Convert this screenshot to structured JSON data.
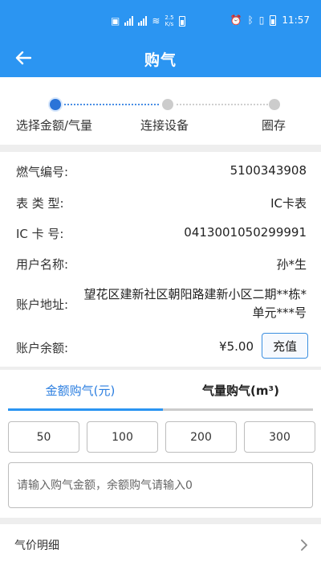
{
  "status_bar": {
    "net_speed_value": "2.5",
    "net_speed_unit": "K/s",
    "time": "11:57"
  },
  "header": {
    "title": "购气"
  },
  "steps": [
    {
      "label": "选择金额/气量",
      "state": "active"
    },
    {
      "label": "连接设备",
      "state": "inactive"
    },
    {
      "label": "圈存",
      "state": "inactive"
    }
  ],
  "info": {
    "gas_number_label": "燃气编号:",
    "gas_number_value": "5100343908",
    "meter_type_label": "表 类 型:",
    "meter_type_value": "IC卡表",
    "ic_card_label": "IC 卡 号:",
    "ic_card_value": "0413001050299991",
    "user_name_label": "用户名称:",
    "user_name_value": "孙*生",
    "address_label": "账户地址:",
    "address_value": "望花区建新社区朝阳路建新小区二期**栋*单元***号",
    "balance_label": "账户余额:",
    "balance_value": "¥5.00",
    "recharge_label": "充值"
  },
  "purchase": {
    "tabs": [
      {
        "label": "金额购气(元)",
        "active": true
      },
      {
        "label": "气量购气(m³)",
        "active": false
      }
    ],
    "amounts": [
      "50",
      "100",
      "200",
      "300"
    ],
    "input_placeholder": "请输入购气金额，余额购气请输入0"
  },
  "price_detail": {
    "label": "气价明细"
  },
  "colors": {
    "header_bg": "#2b95f2",
    "accent_blue": "#2b7ee0",
    "step_active": "#2b74d8",
    "step_inactive": "#cccccc"
  }
}
